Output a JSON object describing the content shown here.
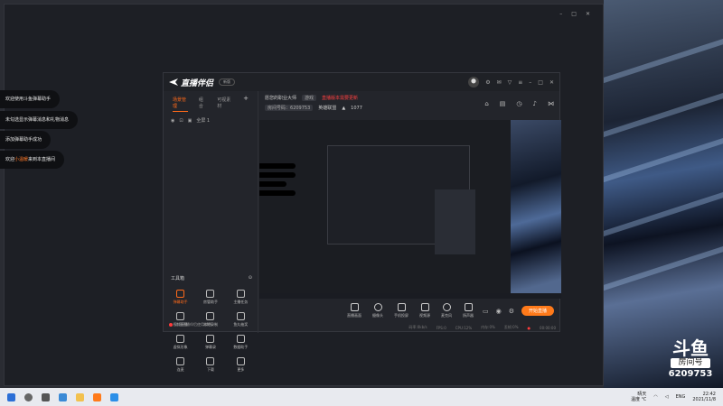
{
  "window": {
    "controls": [
      "–",
      "□",
      "✕"
    ]
  },
  "notifications": [
    {
      "text": "欢迎使用斗鱼弹幕助手"
    },
    {
      "text": "未勾选显示弹幕消息和礼物消息"
    },
    {
      "text": "添加弹幕助手成功"
    },
    {
      "prefix": "欢迎",
      "name": "小温暖",
      "suffix": "来到本直播间"
    }
  ],
  "app": {
    "brand": "直播伴侣",
    "version": "新版",
    "window_controls": [
      "–",
      "□",
      "✕"
    ],
    "tabs": [
      "场景管理",
      "组合",
      "可视素材"
    ],
    "add_label": "+",
    "scene_label": "全屏 1",
    "room": {
      "title": "愿您的职业大师",
      "tag": "游戏",
      "warning": "直播版本需要更新",
      "room_id_label": "房间号码：",
      "room_id": "6209753",
      "category": "英雄联盟",
      "viewers": "1077"
    },
    "toolbox_title": "工具箱",
    "tools": [
      {
        "label": "弹幕助手",
        "active": true
      },
      {
        "label": "房管助手",
        "active": false
      },
      {
        "label": "主播任务",
        "active": false
      },
      {
        "label": "视频直播",
        "active": false
      },
      {
        "label": "本地录制",
        "active": false
      },
      {
        "label": "鱼丸抽奖",
        "active": false
      },
      {
        "label": "虚拟形象",
        "active": false
      },
      {
        "label": "弹幕录",
        "active": false
      },
      {
        "label": "数据助手",
        "active": false
      },
      {
        "label": "连麦",
        "active": false
      },
      {
        "label": "下载",
        "active": false
      },
      {
        "label": "更多",
        "active": false
      }
    ],
    "sidebar_footer": "斗鱼直播伴侣使用说明",
    "controls": [
      {
        "label": "直播画面",
        "icon": "screen"
      },
      {
        "label": "摄像头",
        "icon": "camera"
      },
      {
        "label": "手机投屏",
        "icon": "phone"
      },
      {
        "label": "视频源",
        "icon": "video"
      },
      {
        "label": "麦克风",
        "icon": "mic"
      },
      {
        "label": "扬声器",
        "icon": "speaker"
      }
    ],
    "go_live": "开始直播",
    "status": {
      "bitrate": "码率:0kb/s",
      "fps": "FPS:0",
      "cpu": "CPU:12%",
      "mem": "内存:0%",
      "drop": "丢帧:0%",
      "rec": "●",
      "time": "00:00:00"
    }
  },
  "badge": {
    "logo": "斗鱼",
    "sub": "房间号",
    "number": "6209753"
  },
  "taskbar": {
    "weather": "晴天",
    "weather_sub": "温度 ℃",
    "lang": "ENG",
    "time": "22:42",
    "date": "2021/11/8"
  },
  "colors": {
    "accent": "#ff7a1a",
    "warning": "#ff4040"
  }
}
